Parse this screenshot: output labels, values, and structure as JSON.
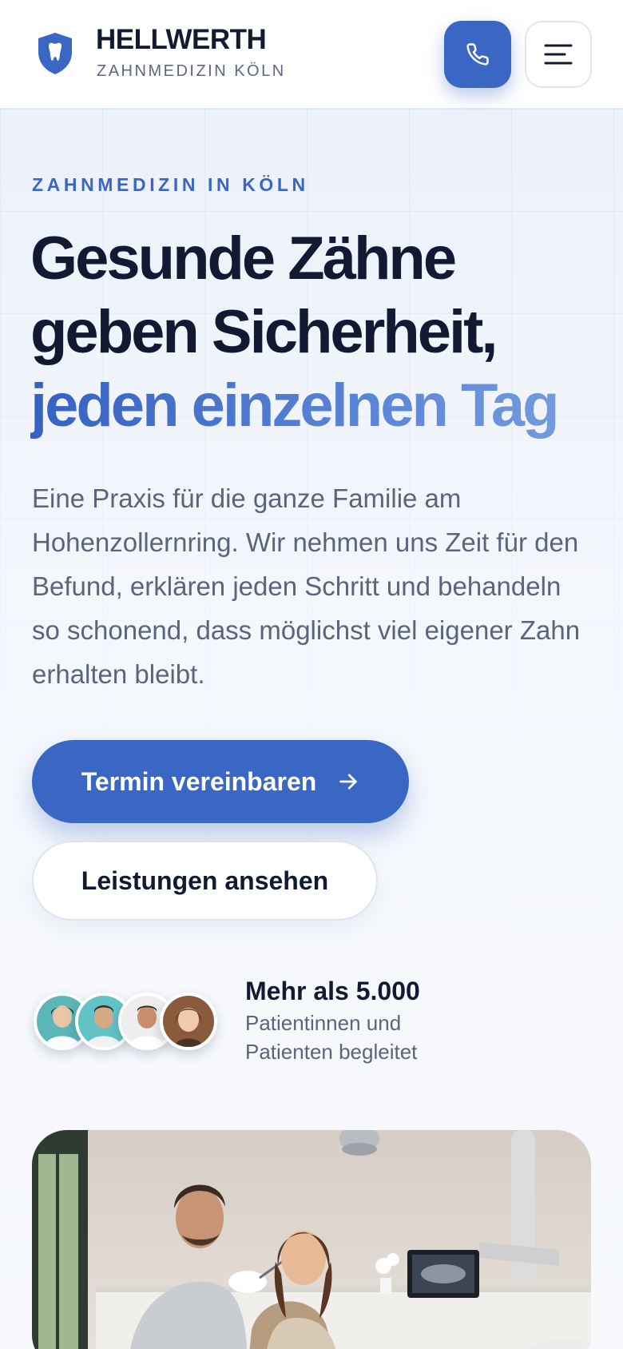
{
  "header": {
    "brand_name": "HELLWERTH",
    "brand_sub": "ZAHNMEDIZIN KÖLN",
    "call_icon": "phone-icon",
    "menu_icon": "hamburger-menu-icon"
  },
  "hero": {
    "eyebrow": "ZAHNMEDIZIN IN KÖLN",
    "headline_line1": "Gesunde Zähne",
    "headline_line2": "geben Sicherheit,",
    "headline_accent": "jeden einzelnen Tag",
    "lead": "Eine Praxis für die ganze Familie am Hohenzollernring. Wir nehmen uns Zeit für den Befund, erklären jeden Schritt und behandeln so schonend, dass möglichst viel eigener Zahn erhalten bleibt.",
    "primary_button": "Termin vereinbaren",
    "primary_button_icon": "arrow-right-icon",
    "secondary_button": "Leistungen ansehen"
  },
  "social_proof": {
    "title": "Mehr als 5.000",
    "subtitle": "Patientinnen und Patienten begleitet",
    "avatar_count": 4
  },
  "colors": {
    "accent": "#3a66c4",
    "text_dark": "#121a33",
    "text_muted": "#5a647d"
  }
}
